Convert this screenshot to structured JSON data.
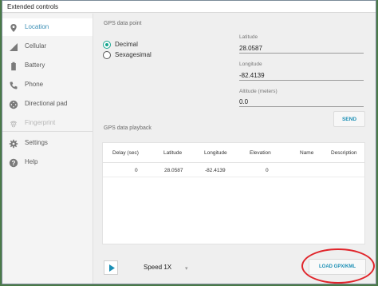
{
  "window": {
    "title": "Extended controls"
  },
  "sidebar": {
    "items": [
      {
        "label": "Location",
        "icon": "location-pin-icon",
        "state": "active"
      },
      {
        "label": "Cellular",
        "icon": "signal-icon",
        "state": "normal"
      },
      {
        "label": "Battery",
        "icon": "battery-icon",
        "state": "normal"
      },
      {
        "label": "Phone",
        "icon": "phone-icon",
        "state": "normal"
      },
      {
        "label": "Directional pad",
        "icon": "dpad-icon",
        "state": "normal"
      },
      {
        "label": "Fingerprint",
        "icon": "fingerprint-icon",
        "state": "disabled"
      },
      {
        "label": "Settings",
        "icon": "gear-icon",
        "state": "normal"
      },
      {
        "label": "Help",
        "icon": "help-icon",
        "state": "normal"
      }
    ]
  },
  "gps_point": {
    "section_label": "GPS data point",
    "format_options": [
      "Decimal",
      "Sexagesimal"
    ],
    "selected_format": "Decimal",
    "latitude_label": "Latitude",
    "latitude_value": "28.0587",
    "longitude_label": "Longitude",
    "longitude_value": "-82.4139",
    "altitude_label": "Altitude (meters)",
    "altitude_value": "0.0",
    "send_label": "SEND"
  },
  "playback": {
    "section_label": "GPS data playback",
    "columns": [
      "Delay (sec)",
      "Latitude",
      "Longitude",
      "Elevation",
      "Name",
      "Description"
    ],
    "rows": [
      [
        "0",
        "28.0587",
        "-82.4139",
        "0",
        "",
        ""
      ]
    ],
    "speed_label": "Speed 1X",
    "load_label": "LOAD GPX/KML"
  },
  "colors": {
    "accent": "#1b8fb5",
    "radio": "#16a58f",
    "highlight": "#e0242a"
  }
}
